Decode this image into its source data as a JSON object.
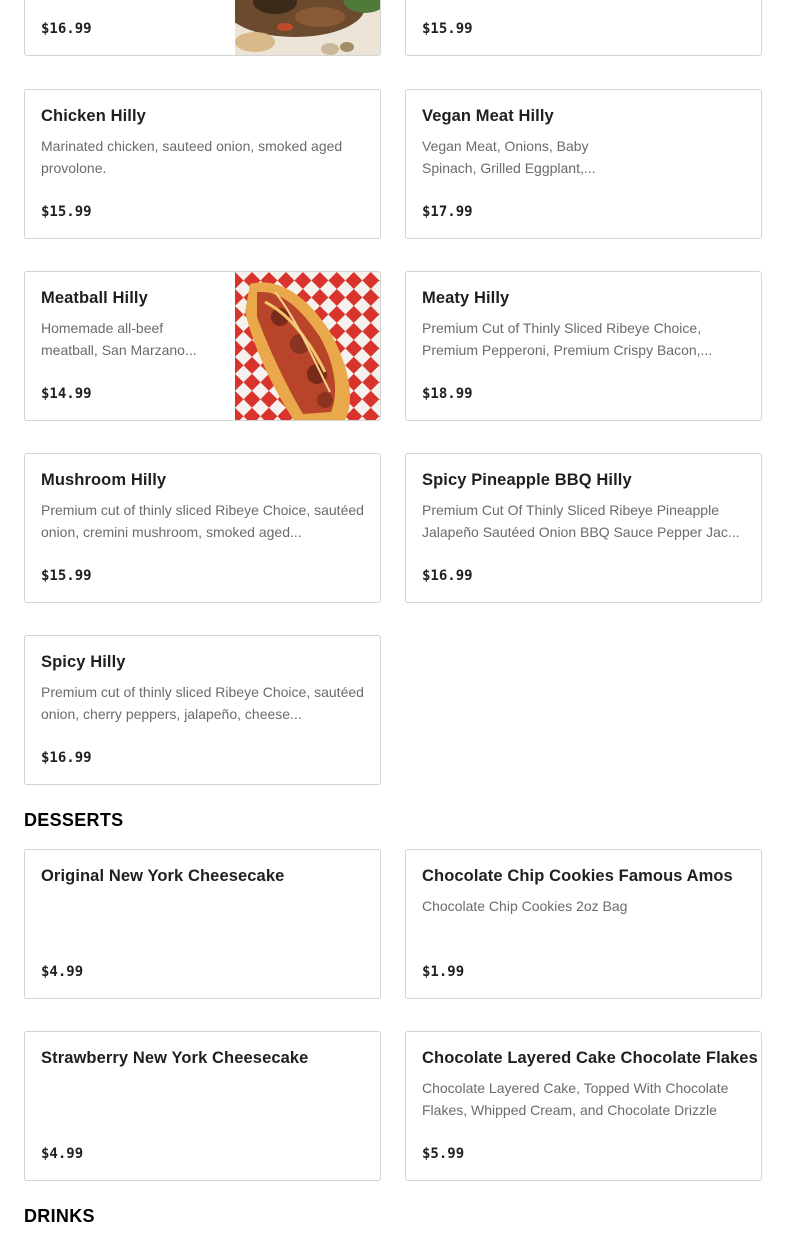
{
  "sections": {
    "desserts": "DESSERTS",
    "drinks": "DRINKS"
  },
  "items": {
    "top_left": {
      "name": "",
      "description": "",
      "price": "$16.99"
    },
    "top_right": {
      "name": "",
      "description": "",
      "price": "$15.99"
    },
    "chicken": {
      "name": "Chicken Hilly",
      "description": "Marinated chicken, sauteed onion, smoked aged provolone.",
      "price": "$15.99"
    },
    "vegan": {
      "name": "Vegan Meat Hilly",
      "description": "Vegan Meat, Onions, Baby Spinach, Grilled Eggplant,...",
      "price": "$17.99"
    },
    "meatball": {
      "name": "Meatball Hilly",
      "description": "Homemade all-beef meatball, San Marzano...",
      "price": "$14.99"
    },
    "meaty": {
      "name": "Meaty Hilly",
      "description": "Premium Cut of Thinly Sliced Ribeye Choice, Premium Pepperoni, Premium Crispy Bacon,...",
      "price": "$18.99"
    },
    "mushroom": {
      "name": "Mushroom Hilly",
      "description": "Premium cut of thinly sliced Ribeye Choice, sautéed onion, cremini mushroom, smoked aged...",
      "price": "$15.99"
    },
    "spicy_pineapple": {
      "name": "Spicy Pineapple BBQ Hilly",
      "description": "Premium Cut Of Thinly Sliced Ribeye Pineapple Jalapeño Sautéed Onion BBQ Sauce Pepper Jac...",
      "price": "$16.99"
    },
    "spicy": {
      "name": "Spicy Hilly",
      "description": "Premium cut of thinly sliced Ribeye Choice, sautéed onion, cherry peppers, jalapeño, cheese...",
      "price": "$16.99"
    },
    "ny_cheesecake": {
      "name": "Original New York Cheesecake",
      "description": "",
      "price": "$4.99"
    },
    "cookies": {
      "name": "Chocolate Chip Cookies Famous Amos",
      "description": "Chocolate Chip Cookies 2oz Bag",
      "price": "$1.99"
    },
    "strawberry_cheesecake": {
      "name": "Strawberry New York Cheesecake",
      "description": "",
      "price": "$4.99"
    },
    "choc_cake": {
      "name": "Chocolate Layered Cake Chocolate Flakes",
      "description": "Chocolate Layered Cake, Topped With Chocolate Flakes, Whipped Cream, and Chocolate Drizzle",
      "price": "$5.99"
    }
  }
}
